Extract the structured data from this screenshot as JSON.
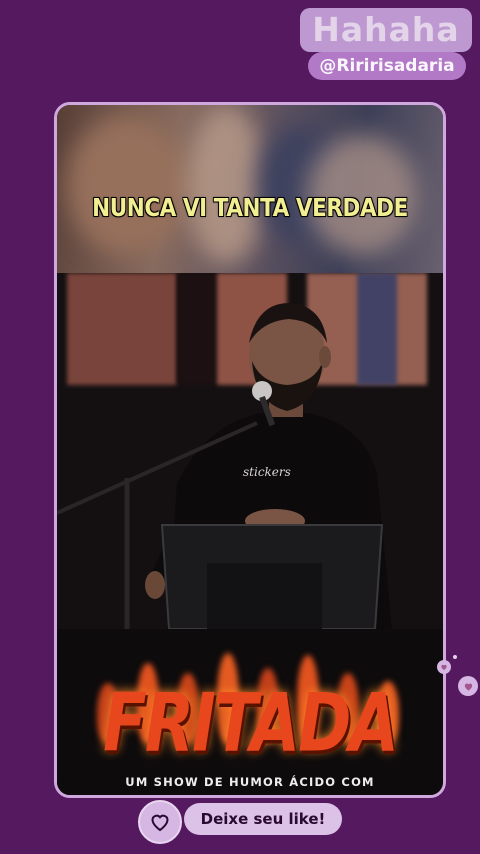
{
  "watermark": {
    "title": "Hahaha",
    "handle": "@Riririsadaria"
  },
  "video": {
    "caption": "NUNCA VI TANTA VERDADE",
    "shirt_text": "stickers"
  },
  "banner": {
    "title": "FRITADA",
    "subtitle": "UM SHOW DE HUMOR ÁCIDO COM"
  },
  "like": {
    "label": "Deixe seu like!",
    "icon": "heart-icon"
  },
  "colors": {
    "background": "#54195f",
    "frame_border": "#cfa8dd",
    "caption": "#f3f088",
    "fritada": "#e8461c"
  }
}
